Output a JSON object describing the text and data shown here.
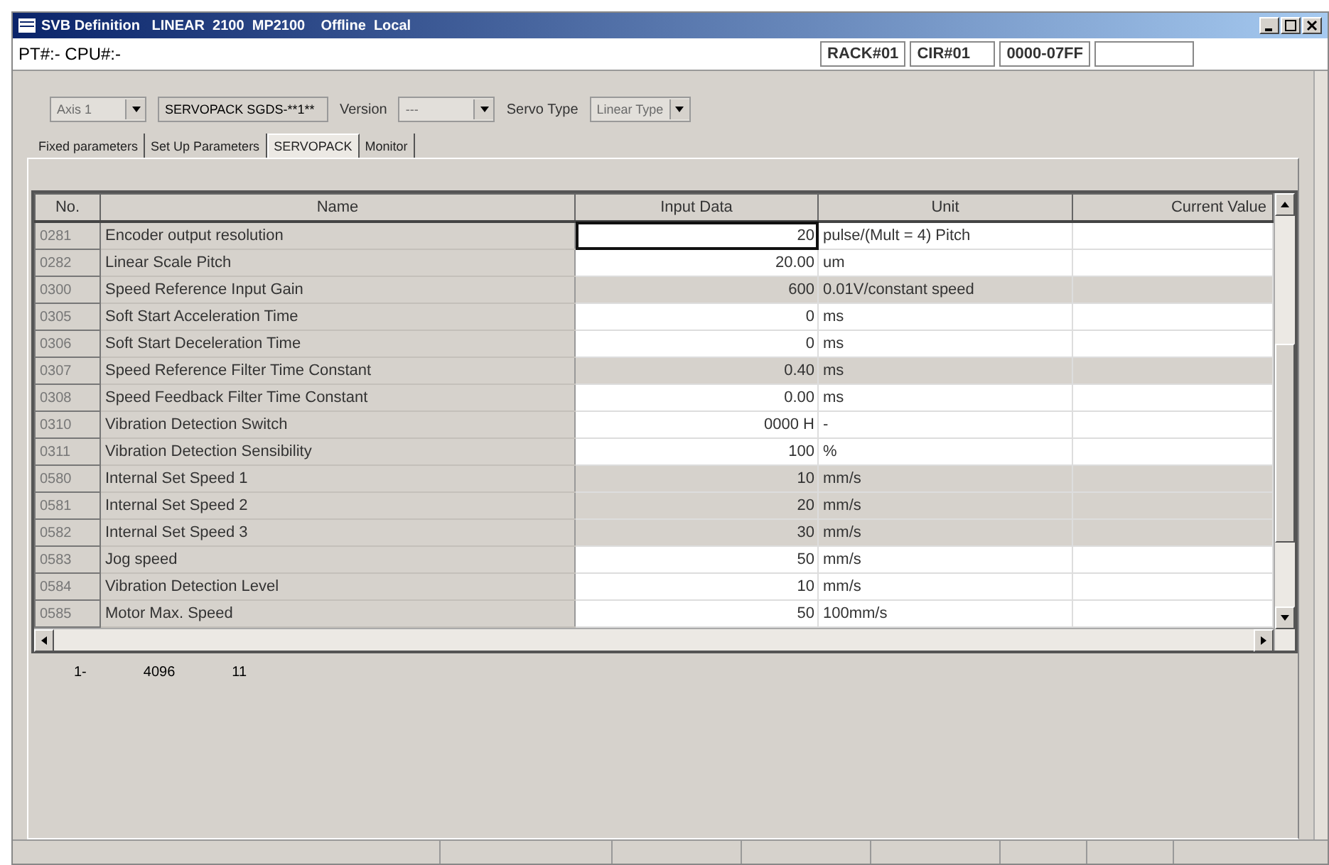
{
  "window": {
    "title": "SVB Definition   LINEAR  2100  MP2100    Offline  Local"
  },
  "info_bar": {
    "left": "PT#:- CPU#:-",
    "fields": [
      "RACK#01",
      "CIR#01",
      "0000-07FF"
    ]
  },
  "selectors": [
    {
      "kind": "combo",
      "value": "Axis 1",
      "disabled": true
    },
    {
      "kind": "text",
      "value": "SERVOPACK SGDS-**1**",
      "disabled": false
    },
    {
      "kind": "combo",
      "label": "Version",
      "value": "---",
      "disabled": true
    },
    {
      "kind": "combo",
      "label": "Servo Type",
      "value": "Linear Type",
      "disabled": true
    }
  ],
  "tabs": [
    {
      "label": "Fixed parameters",
      "selected": false
    },
    {
      "label": "Set Up Parameters",
      "selected": false
    },
    {
      "label": "SERVOPACK",
      "selected": true
    },
    {
      "label": "Monitor",
      "selected": false
    }
  ],
  "table": {
    "columns": [
      "No.",
      "Name",
      "Input Data",
      "Unit",
      "Current Value"
    ],
    "rows": [
      {
        "no": "0281",
        "name": "Encoder output resolution",
        "input": "20",
        "unit": "pulse/(Mult = 4) Pitch",
        "shaded": false,
        "focused": true
      },
      {
        "no": "0282",
        "name": "Linear Scale Pitch",
        "input": "20.00",
        "unit": "um",
        "shaded": false,
        "focused": false
      },
      {
        "no": "0300",
        "name": "Speed Reference Input Gain",
        "input": "600",
        "unit": "0.01V/constant speed",
        "shaded": true,
        "focused": false
      },
      {
        "no": "0305",
        "name": "Soft Start Acceleration Time",
        "input": "0",
        "unit": "ms",
        "shaded": false,
        "focused": false
      },
      {
        "no": "0306",
        "name": "Soft Start Deceleration Time",
        "input": "0",
        "unit": "ms",
        "shaded": false,
        "focused": false
      },
      {
        "no": "0307",
        "name": "Speed Reference Filter Time Constant",
        "input": "0.40",
        "unit": "ms",
        "shaded": true,
        "focused": false
      },
      {
        "no": "0308",
        "name": "Speed Feedback Filter Time Constant",
        "input": "0.00",
        "unit": "ms",
        "shaded": false,
        "focused": false
      },
      {
        "no": "0310",
        "name": "Vibration Detection Switch",
        "input": "0000 H",
        "unit": "-",
        "shaded": false,
        "focused": false
      },
      {
        "no": "0311",
        "name": "Vibration Detection Sensibility",
        "input": "100",
        "unit": "%",
        "shaded": false,
        "focused": false
      },
      {
        "no": "0580",
        "name": "Internal Set Speed 1",
        "input": "10",
        "unit": "mm/s",
        "shaded": true,
        "focused": false
      },
      {
        "no": "0581",
        "name": "Internal Set Speed 2",
        "input": "20",
        "unit": "mm/s",
        "shaded": true,
        "focused": false
      },
      {
        "no": "0582",
        "name": "Internal Set Speed 3",
        "input": "30",
        "unit": "mm/s",
        "shaded": true,
        "focused": false
      },
      {
        "no": "0583",
        "name": "Jog speed",
        "input": "50",
        "unit": "mm/s",
        "shaded": false,
        "focused": false
      },
      {
        "no": "0584",
        "name": "Vibration Detection Level",
        "input": "10",
        "unit": "mm/s",
        "shaded": false,
        "focused": false
      },
      {
        "no": "0585",
        "name": "Motor Max. Speed",
        "input": "50",
        "unit": "100mm/s",
        "shaded": false,
        "focused": false
      }
    ]
  },
  "range": {
    "from": "1-",
    "to": "4096",
    "count": "11"
  }
}
